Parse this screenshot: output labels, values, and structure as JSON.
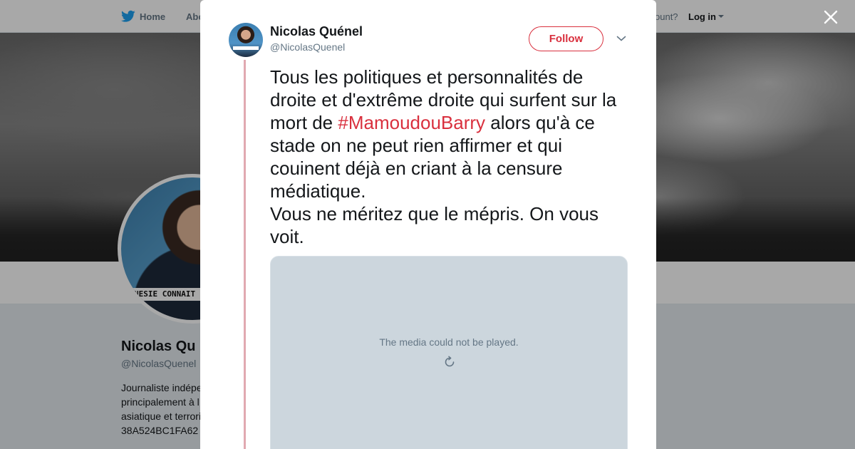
{
  "nav": {
    "home_label": "Home",
    "about_label": "Abo",
    "account_prompt": "ccount?",
    "login_label": "Log in"
  },
  "profile": {
    "name": "Nicolas Qu",
    "handle": "@NicolasQuenel",
    "avatar_caption": "NESIE CONNAIT P",
    "bio_lines": [
      "Journaliste indépe",
      "principalement à l",
      "asiatique et terrori",
      "38A524BC1FA62"
    ]
  },
  "tweet": {
    "author_name": "Nicolas Quénel",
    "author_handle": "@NicolasQuenel",
    "follow_label": "Follow",
    "text_before": "Tous les politiques et personnalités de droite et d'extrême droite qui surfent sur la mort de ",
    "hashtag": "#MamoudouBarry",
    "text_after": " alors qu'à ce stade on ne peut rien affirmer et qui couinent déjà en criant à la censure médiatique.",
    "text_line2": "Vous ne méritez que le mépris. On vous voit.",
    "media_error": "The media could not be played."
  },
  "colors": {
    "accent": "#d9303e",
    "thread_line": "#e1a9b1",
    "media_bg": "#ccd6dd",
    "twitter_blue": "#1da1f2"
  },
  "icons": {
    "nav_logo": "twitter-bird-icon",
    "close": "close-icon",
    "more": "chevron-down-icon",
    "retry": "refresh-icon"
  }
}
